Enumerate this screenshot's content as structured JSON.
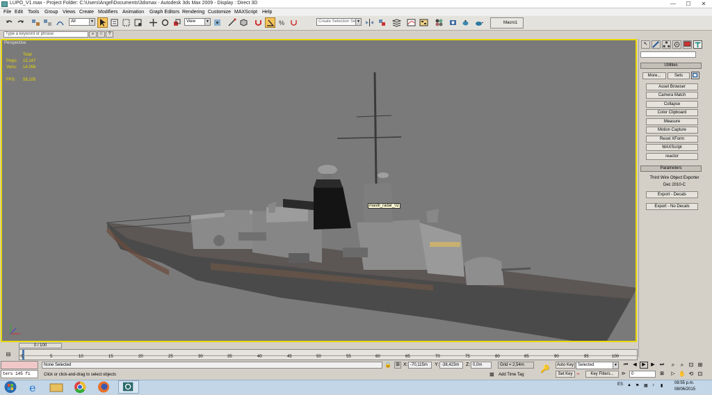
{
  "window": {
    "title": "LUPO_V1.max   - Project Folder: C:\\Users\\Angel\\Documents\\3dsmax   - Autodesk 3ds Max  2009    - Display : Direct 3D",
    "min": "—",
    "max": "☐",
    "close": "✕"
  },
  "menu": [
    "File",
    "Edit",
    "Tools",
    "Group",
    "Views",
    "Create",
    "Modifiers",
    "Animation",
    "Graph Editors",
    "Rendering",
    "Customize",
    "MAXScript",
    "Help"
  ],
  "toolbar": {
    "filter_value": "All",
    "refcoord_value": "View",
    "selection_set_placeholder": "Create Selection Set",
    "macro_label": "Macro1"
  },
  "search": {
    "placeholder": "Type a keyword or phrase"
  },
  "viewport": {
    "label": "Perspective",
    "stats": {
      "total_label": "Total",
      "polys_label": "Polys:",
      "polys_value": "15.147",
      "verts_label": "Verts:",
      "verts_value": "14.056",
      "fps_label": "FPS:",
      "fps_value": "58,105"
    },
    "tooltip": "mastil_radar_02"
  },
  "command_panel": {
    "utilities_title": "Utilities",
    "more_button": "More...",
    "sets_button": "Sets",
    "utility_buttons": [
      "Asset Browser",
      "Camera Match",
      "Collapse",
      "Color Clipboard",
      "Measure",
      "Motion Capture",
      "Reset XForm",
      "MAXScript",
      "reactor"
    ],
    "parameters_title": "Parameters",
    "exporter_line1": "Third Wire Object Exporter",
    "exporter_line2": "Dec 2010-C",
    "export_decals": "Export - Decals",
    "export_no_decals": "Export - No Decals"
  },
  "timeline": {
    "slider_label": "0 / 100",
    "ticks": [
      "0",
      "5",
      "10",
      "15",
      "20",
      "25",
      "30",
      "35",
      "40",
      "45",
      "50",
      "55",
      "60",
      "65",
      "70",
      "75",
      "80",
      "85",
      "90",
      "95",
      "100"
    ]
  },
  "status": {
    "script_listener": "ters 145 fi",
    "selection": "None Selected",
    "prompt": "Click or click-and-drag to select objects",
    "x_label": "X:",
    "x_value": "-70,115m",
    "y_label": "Y:",
    "y_value": "-38,423m",
    "z_label": "Z:",
    "z_value": "0,0m",
    "grid": "Grid = 2,54m",
    "add_time_tag": "Add Time Tag",
    "auto_key": "Auto Key",
    "set_key": "Set Key",
    "key_mode_value": "Selected",
    "key_filters": "Key Filters...",
    "frame_value": "0"
  },
  "taskbar": {
    "lang": "ES",
    "time": "08:55 p.m.",
    "date": "08/06/2015"
  }
}
